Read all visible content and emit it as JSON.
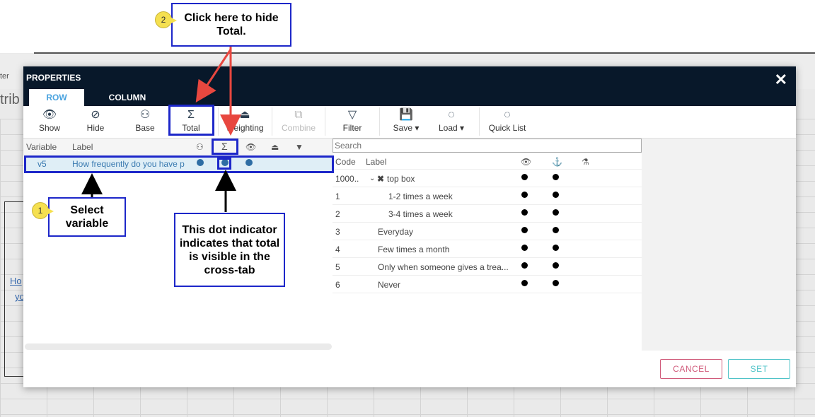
{
  "background": {
    "frag1": "ter",
    "frag2": "trib",
    "frag3": "Ho",
    "frag4": "yo"
  },
  "modal": {
    "title": "PROPERTIES",
    "tabs": [
      {
        "label": "ROW"
      },
      {
        "label": "COLUMN"
      }
    ],
    "toolbar": [
      {
        "label": "Show",
        "icon": "eye-icon"
      },
      {
        "label": "Hide",
        "icon": "eye-slash-icon"
      },
      {
        "label": "Base",
        "icon": "users-icon"
      },
      {
        "label": "Total",
        "icon": "sigma-icon"
      },
      {
        "label": "Weighting",
        "icon": "weight-icon"
      },
      {
        "label": "Combine",
        "icon": "combine-icon"
      },
      {
        "label": "Filter",
        "icon": "filter-icon"
      },
      {
        "label": "Save ▾",
        "icon": "save-icon"
      },
      {
        "label": "Load ▾",
        "icon": "spinner-icon"
      },
      {
        "label": "Quick List",
        "icon": "spinner-icon"
      }
    ],
    "left": {
      "col_variable": "Variable",
      "col_label": "Label",
      "row": {
        "variable": "v5",
        "label": "How frequently do you have p"
      }
    },
    "right": {
      "search_placeholder": "Search",
      "col_code": "Code",
      "col_label": "Label",
      "rows": [
        {
          "code": "1000..",
          "label": "top box"
        },
        {
          "code": "1",
          "label": "1-2 times a week"
        },
        {
          "code": "2",
          "label": "3-4 times a week"
        },
        {
          "code": "3",
          "label": "Everyday"
        },
        {
          "code": "4",
          "label": "Few times a month"
        },
        {
          "code": "5",
          "label": "Only when someone gives a trea..."
        },
        {
          "code": "6",
          "label": "Never"
        }
      ]
    },
    "buttons": {
      "cancel": "CANCEL",
      "set": "SET"
    }
  },
  "annotations": {
    "step1_number": "1",
    "step1_text": "Select variable",
    "step2_number": "2",
    "step2_text": "Click here to hide Total.",
    "dot_note": "This dot indicator indicates that total is visible in the cross-tab",
    "color": "#1d27c9"
  }
}
